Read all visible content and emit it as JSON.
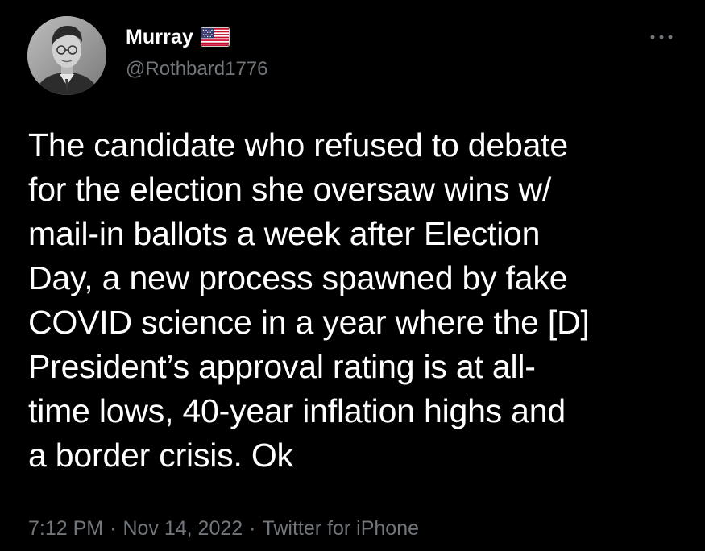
{
  "tweet": {
    "author": {
      "display_name": "Murray",
      "handle": "@Rothbard1776",
      "badge_icon": "us-flag-icon"
    },
    "more_icon": "more-horizontal-icon",
    "text": "The candidate who refused to debate\nfor the election she oversaw wins w/\nmail-in ballots a week after Election\nDay, a new process spawned by fake\nCOVID science in a year where the [D]\nPresident’s approval rating is at all-\ntime lows, 40-year inflation highs and\na border crisis. Ok",
    "time": "7:12 PM",
    "separator": "·",
    "date": "Nov 14, 2022",
    "source": "Twitter for iPhone"
  },
  "colors": {
    "background": "#000000",
    "text_primary": "#ffffff",
    "text_secondary": "#71767b"
  }
}
